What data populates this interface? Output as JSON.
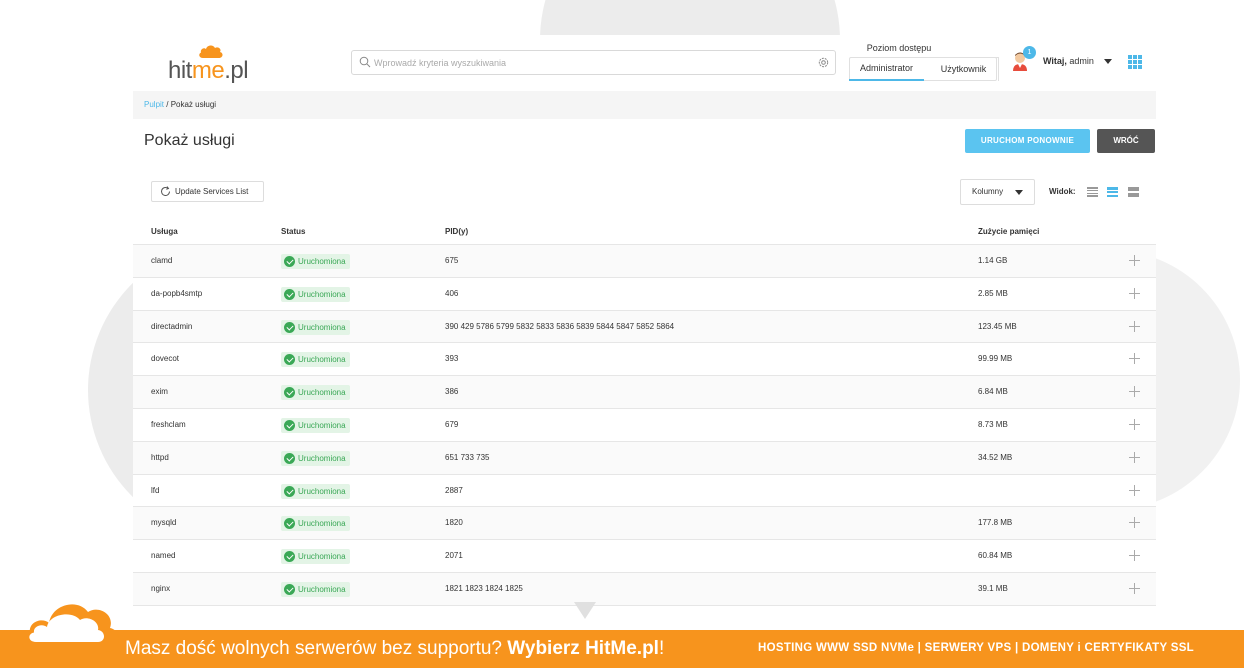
{
  "header": {
    "logo_text_1": "hit",
    "logo_text_2": "me",
    "logo_text_3": ".pl",
    "search_placeholder": "Wprowadź kryteria wyszukiwania",
    "access_label": "Poziom dostępu",
    "access_tabs": [
      "Administrator",
      "Użytkownik"
    ],
    "notification_count": "1",
    "welcome_prefix": "Witaj,",
    "welcome_user": " admin"
  },
  "breadcrumb": {
    "root": "Pulpit",
    "separator": " / ",
    "current": "Pokaż usługi"
  },
  "page": {
    "title": "Pokaż usługi",
    "restart_button": "URUCHOM PONOWNIE",
    "back_button": "WRÓĆ",
    "update_button": "Update Services List",
    "columns_dropdown": "Kolumny",
    "view_label": "Widok:"
  },
  "table": {
    "headers": [
      "Usługa",
      "Status",
      "PID(y)",
      "Zużycie pamięci"
    ],
    "rows": [
      {
        "service": "clamd",
        "status": "Uruchomiona",
        "pids": "675",
        "memory": "1.14 GB"
      },
      {
        "service": "da-popb4smtp",
        "status": "Uruchomiona",
        "pids": "406",
        "memory": "2.85 MB"
      },
      {
        "service": "directadmin",
        "status": "Uruchomiona",
        "pids": "390 429 5786 5799 5832 5833 5836 5839 5844 5847 5852 5864",
        "memory": "123.45 MB"
      },
      {
        "service": "dovecot",
        "status": "Uruchomiona",
        "pids": "393",
        "memory": "99.99 MB"
      },
      {
        "service": "exim",
        "status": "Uruchomiona",
        "pids": "386",
        "memory": "6.84 MB"
      },
      {
        "service": "freshclam",
        "status": "Uruchomiona",
        "pids": "679",
        "memory": "8.73 MB"
      },
      {
        "service": "httpd",
        "status": "Uruchomiona",
        "pids": "651 733 735",
        "memory": "34.52 MB"
      },
      {
        "service": "lfd",
        "status": "Uruchomiona",
        "pids": "2887",
        "memory": ""
      },
      {
        "service": "mysqld",
        "status": "Uruchomiona",
        "pids": "1820",
        "memory": "177.8 MB"
      },
      {
        "service": "named",
        "status": "Uruchomiona",
        "pids": "2071",
        "memory": "60.84 MB"
      },
      {
        "service": "nginx",
        "status": "Uruchomiona",
        "pids": "1821 1823 1824 1825",
        "memory": "39.1 MB"
      }
    ]
  },
  "banner": {
    "text_prefix": "Masz dość wolnych serwerów bez supportu? ",
    "text_bold": "Wybierz HitMe.pl",
    "text_suffix": "!",
    "right_text": "HOSTING WWW SSD NVMe | SERWERY VPS | DOMENY i CERTYFIKATY SSL"
  },
  "colors": {
    "accent": "#4db8e8",
    "brand_orange": "#f7941d",
    "status_green": "#3aa856"
  }
}
